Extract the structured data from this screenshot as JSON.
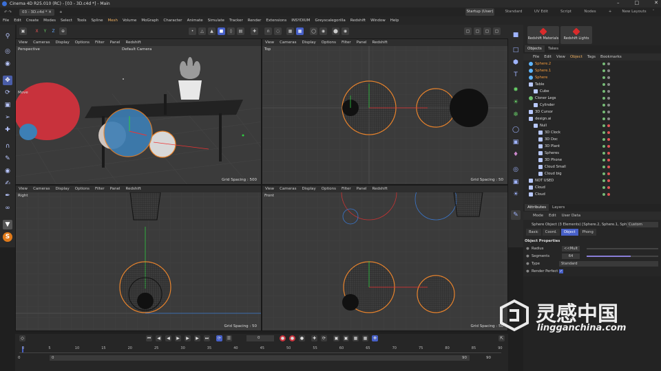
{
  "window": {
    "title": "Cinema 4D R25.010 (RC) - [03 - 3D.c4d *] - Main"
  },
  "doc_tab": "03 - 3D.c4d *",
  "layouts": {
    "items": [
      "Startup (User)",
      "Standard",
      "UV Edit",
      "Script",
      "Nodes"
    ],
    "active": "Startup (User)",
    "new_layouts": "New Layouts"
  },
  "menu": [
    "File",
    "Edit",
    "Create",
    "Modes",
    "Select",
    "Tools",
    "Spline",
    "Mesh",
    "Volume",
    "MoGraph",
    "Character",
    "Animate",
    "Simulate",
    "Tracker",
    "Render",
    "Extensions",
    "INSYDIUM",
    "Greyscalegorilla",
    "Redshift",
    "Window",
    "Help"
  ],
  "toolbar": {
    "x": "X",
    "y": "Y",
    "z": "Z"
  },
  "viewport_menu": [
    "View",
    "Cameras",
    "Display",
    "Options",
    "Filter",
    "Panel",
    "Redshift"
  ],
  "viewports": {
    "perspective": {
      "name": "Perspective",
      "camera": "Default Camera",
      "tool": "Move"
    },
    "top": {
      "name": "Top",
      "grid": "Grid Spacing : 50"
    },
    "right": {
      "name": "Right",
      "grid": "Grid Spacing : 50"
    },
    "front": {
      "name": "Front",
      "grid": "Grid Spacing : 50"
    },
    "persp_grid": "Grid Spacing : 500"
  },
  "redshift": {
    "materials": "Redshift Materials",
    "lights": "Redshift Lights"
  },
  "panel_tabs": {
    "objects": "Objects",
    "takes": "Takes"
  },
  "object_menu": [
    "File",
    "Edit",
    "View",
    "Object",
    "Tags",
    "Bookmarks"
  ],
  "objects": [
    {
      "name": "Sphere.2",
      "indent": 0,
      "orange": true,
      "icon": "sphere"
    },
    {
      "name": "Sphere.1",
      "indent": 0,
      "orange": true,
      "icon": "sphere"
    },
    {
      "name": "Sphere",
      "indent": 0,
      "orange": true,
      "icon": "sphere"
    },
    {
      "name": "Table",
      "indent": 0,
      "orange": false,
      "icon": "null"
    },
    {
      "name": "Cube",
      "indent": 1,
      "orange": false,
      "icon": "cube"
    },
    {
      "name": "Cloner Legs",
      "indent": 0,
      "orange": false,
      "icon": "cloner"
    },
    {
      "name": "Cylinder",
      "indent": 1,
      "orange": false,
      "icon": "cylinder"
    },
    {
      "name": "3D Cursor",
      "indent": 0,
      "orange": false,
      "icon": "null"
    },
    {
      "name": "design.ai",
      "indent": 0,
      "orange": false,
      "icon": "null"
    },
    {
      "name": "Null",
      "indent": 1,
      "orange": false,
      "icon": "null"
    },
    {
      "name": "3D Clock",
      "indent": 2,
      "orange": false,
      "icon": "null"
    },
    {
      "name": "3D Doc",
      "indent": 2,
      "orange": false,
      "icon": "null"
    },
    {
      "name": "3D Plant",
      "indent": 2,
      "orange": false,
      "icon": "null"
    },
    {
      "name": "Spheres",
      "indent": 2,
      "orange": false,
      "icon": "null"
    },
    {
      "name": "3D Phone",
      "indent": 2,
      "orange": false,
      "icon": "null"
    },
    {
      "name": "Cloud Small",
      "indent": 2,
      "orange": false,
      "icon": "null"
    },
    {
      "name": "Cloud big",
      "indent": 2,
      "orange": false,
      "icon": "null"
    },
    {
      "name": "NOT USED",
      "indent": 0,
      "orange": false,
      "icon": "null"
    },
    {
      "name": "Cloud",
      "indent": 0,
      "orange": false,
      "icon": "null"
    },
    {
      "name": "Cloud",
      "indent": 0,
      "orange": false,
      "icon": "null"
    }
  ],
  "attr_tabs": {
    "attributes": "Attributes",
    "layers": "Layers"
  },
  "attr_menu": [
    "Mode",
    "Edit",
    "User Data"
  ],
  "attr_header": {
    "title": "Sphere Object (3 Elements) [Sphere.2, Sphere.1, Sphere]",
    "mode": "Custom"
  },
  "attr_subtabs": {
    "items": [
      "Basic",
      "Coord.",
      "Object",
      "Phong"
    ],
    "active": "Object"
  },
  "object_properties": {
    "heading": "Object Properties",
    "radius_label": "Radius",
    "radius_value": "<<Mult",
    "segments_label": "Segments",
    "segments_value": "64",
    "type_label": "Type",
    "type_value": "Standard",
    "render_perfect_label": "Render Perfect"
  },
  "timeline": {
    "frame": "0",
    "ticks": [
      "0",
      "5",
      "10",
      "15",
      "20",
      "25",
      "30",
      "35",
      "40",
      "45",
      "50",
      "55",
      "60",
      "65",
      "70",
      "75",
      "80",
      "85",
      "90"
    ],
    "start": "0",
    "start2": "0",
    "end": "90",
    "end2": "90"
  },
  "watermark": {
    "cn": "灵感中国",
    "url": "lingganchina.com"
  },
  "colors": {
    "accent": "#4760c8",
    "selection": "#f39a3b",
    "red_sphere": "#c8323c",
    "blue_sphere": "#3d7fb5"
  }
}
